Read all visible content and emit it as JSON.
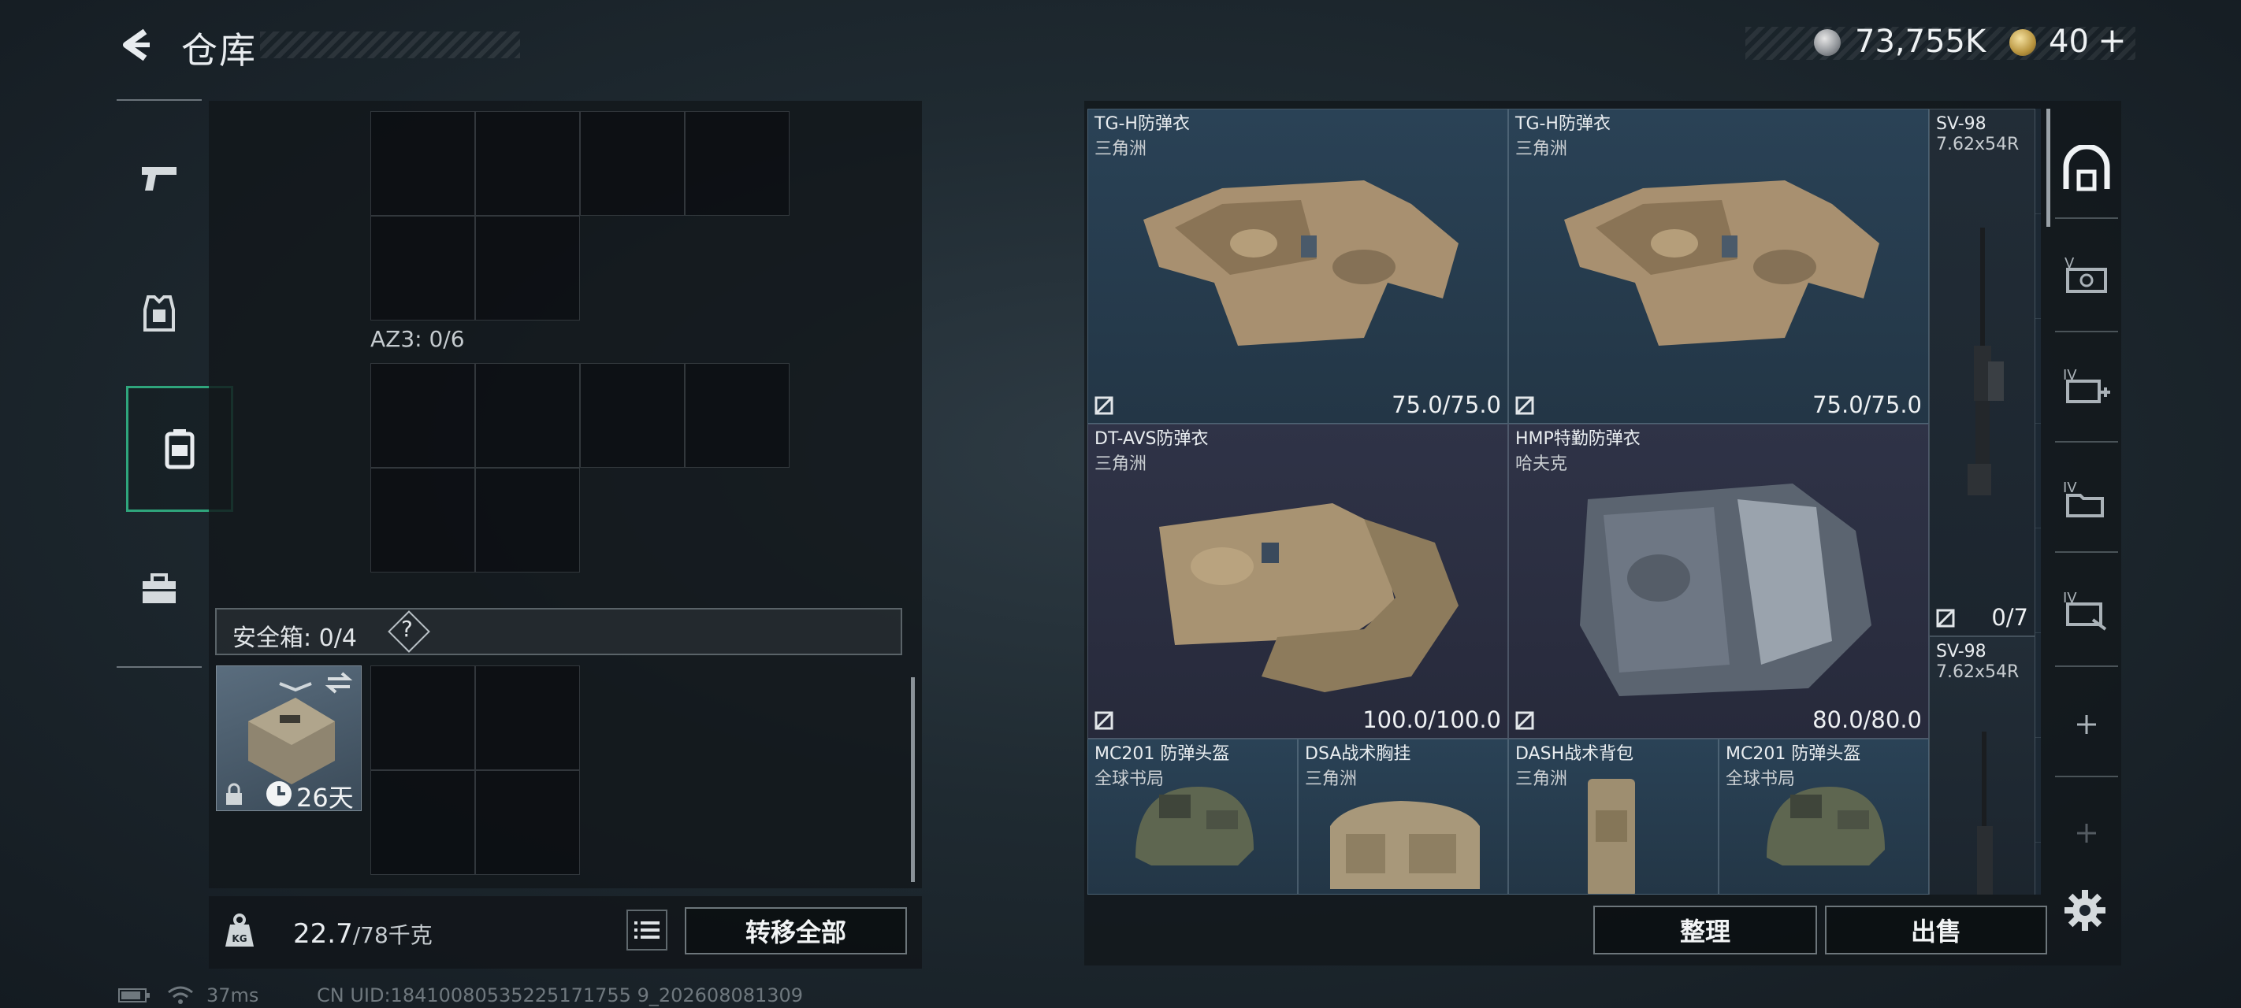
{
  "header": {
    "title": "仓库",
    "currency_silver": "73,755K",
    "currency_gold": "40",
    "gold_plus": "+"
  },
  "nav": {
    "items": [
      "weapon-icon",
      "armor-icon",
      "backpack-icon",
      "toolbox-icon"
    ],
    "active_index": 2
  },
  "left": {
    "rig_label": "AZ3: 0/6",
    "safe_label": "安全箱: 0/4",
    "safe_help": "?",
    "case_days": "26天",
    "weight_current": "22.7",
    "weight_max": "/78千克",
    "transfer_all": "转移全部"
  },
  "items": [
    {
      "name": "TG-H防弹衣",
      "sub": "三角洲",
      "value": "75.0/75.0",
      "rarity": "blue"
    },
    {
      "name": "TG-H防弹衣",
      "sub": "三角洲",
      "value": "75.0/75.0",
      "rarity": "blue"
    },
    {
      "name": "SV-98",
      "sub": "7.62x54R",
      "value": "0/7",
      "rarity": "dark"
    },
    {
      "name": "DT-AVS防弹衣",
      "sub": "三角洲",
      "value": "100.0/100.0",
      "rarity": "purple"
    },
    {
      "name": "HMP特勤防弹衣",
      "sub": "哈夫克",
      "value": "80.0/80.0",
      "rarity": "purple"
    },
    {
      "name": "SV-98",
      "sub": "7.62x54R",
      "value": "",
      "rarity": "dark"
    },
    {
      "name": "MC201 防弹头盔",
      "sub": "全球书局",
      "value": "",
      "rarity": "blue"
    },
    {
      "name": "DSA战术胸挂",
      "sub": "三角洲",
      "value": "",
      "rarity": "blue"
    },
    {
      "name": "DASH战术背包",
      "sub": "三角洲",
      "value": "",
      "rarity": "blue"
    },
    {
      "name": "MC201 防弹头盔",
      "sub": "全球书局",
      "value": "",
      "rarity": "blue"
    }
  ],
  "buttons": {
    "sort": "整理",
    "sell": "出售"
  },
  "side_tabs": [
    "home-vault-icon",
    "tab-v-icon",
    "tab-iv-medkit-icon",
    "tab-iv-folder-icon",
    "tab-iv-arrow-icon",
    "add-tab-icon",
    "add-tab-icon-disabled"
  ],
  "status": {
    "ping": "37ms",
    "uid": "CN UID:18410080535225171755 9_202608081309"
  },
  "colors": {
    "accent_green": "#2fa57c",
    "rarity_blue": "#2a4256",
    "rarity_purple": "#2f3347"
  }
}
